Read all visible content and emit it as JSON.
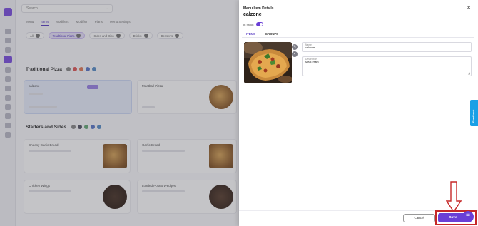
{
  "background": {
    "search_placeholder": "Search",
    "tabs": [
      "Menu",
      "Items",
      "Modifiers",
      "Modifier",
      "Plans",
      "Menu Settings"
    ],
    "chips": [
      "All",
      "Traditional Pizza",
      "Sides and Dips",
      "Drinks",
      "Desserts",
      "Salads"
    ],
    "sections": [
      "Traditional Pizza",
      "Starters and Sides"
    ],
    "cards": [
      {
        "name": "calzone"
      },
      {
        "name": "Meatball Pizza"
      },
      {
        "name": "Cheesy Garlic Bread"
      },
      {
        "name": "Garlic Bread"
      },
      {
        "name": "Chicken Wings"
      },
      {
        "name": "Loaded Potato Wedges"
      }
    ]
  },
  "drawer": {
    "title": "Menu Item Details",
    "item_name": "calzone",
    "in_stock_label": "In Stock",
    "in_stock": true,
    "tabs": [
      "ITEMS",
      "GROUPS"
    ],
    "active_tab": "ITEMS",
    "name_field": {
      "label": "Name",
      "value": "calzone"
    },
    "description_field": {
      "label": "Description",
      "value": "Meat, Ham"
    },
    "cancel_label": "Cancel",
    "save_label": "Save"
  },
  "feedback_label": "Feedback",
  "colors": {
    "accent": "#6a3fd6",
    "highlight_outline": "#c62828",
    "feedback": "#1aa0e6"
  }
}
